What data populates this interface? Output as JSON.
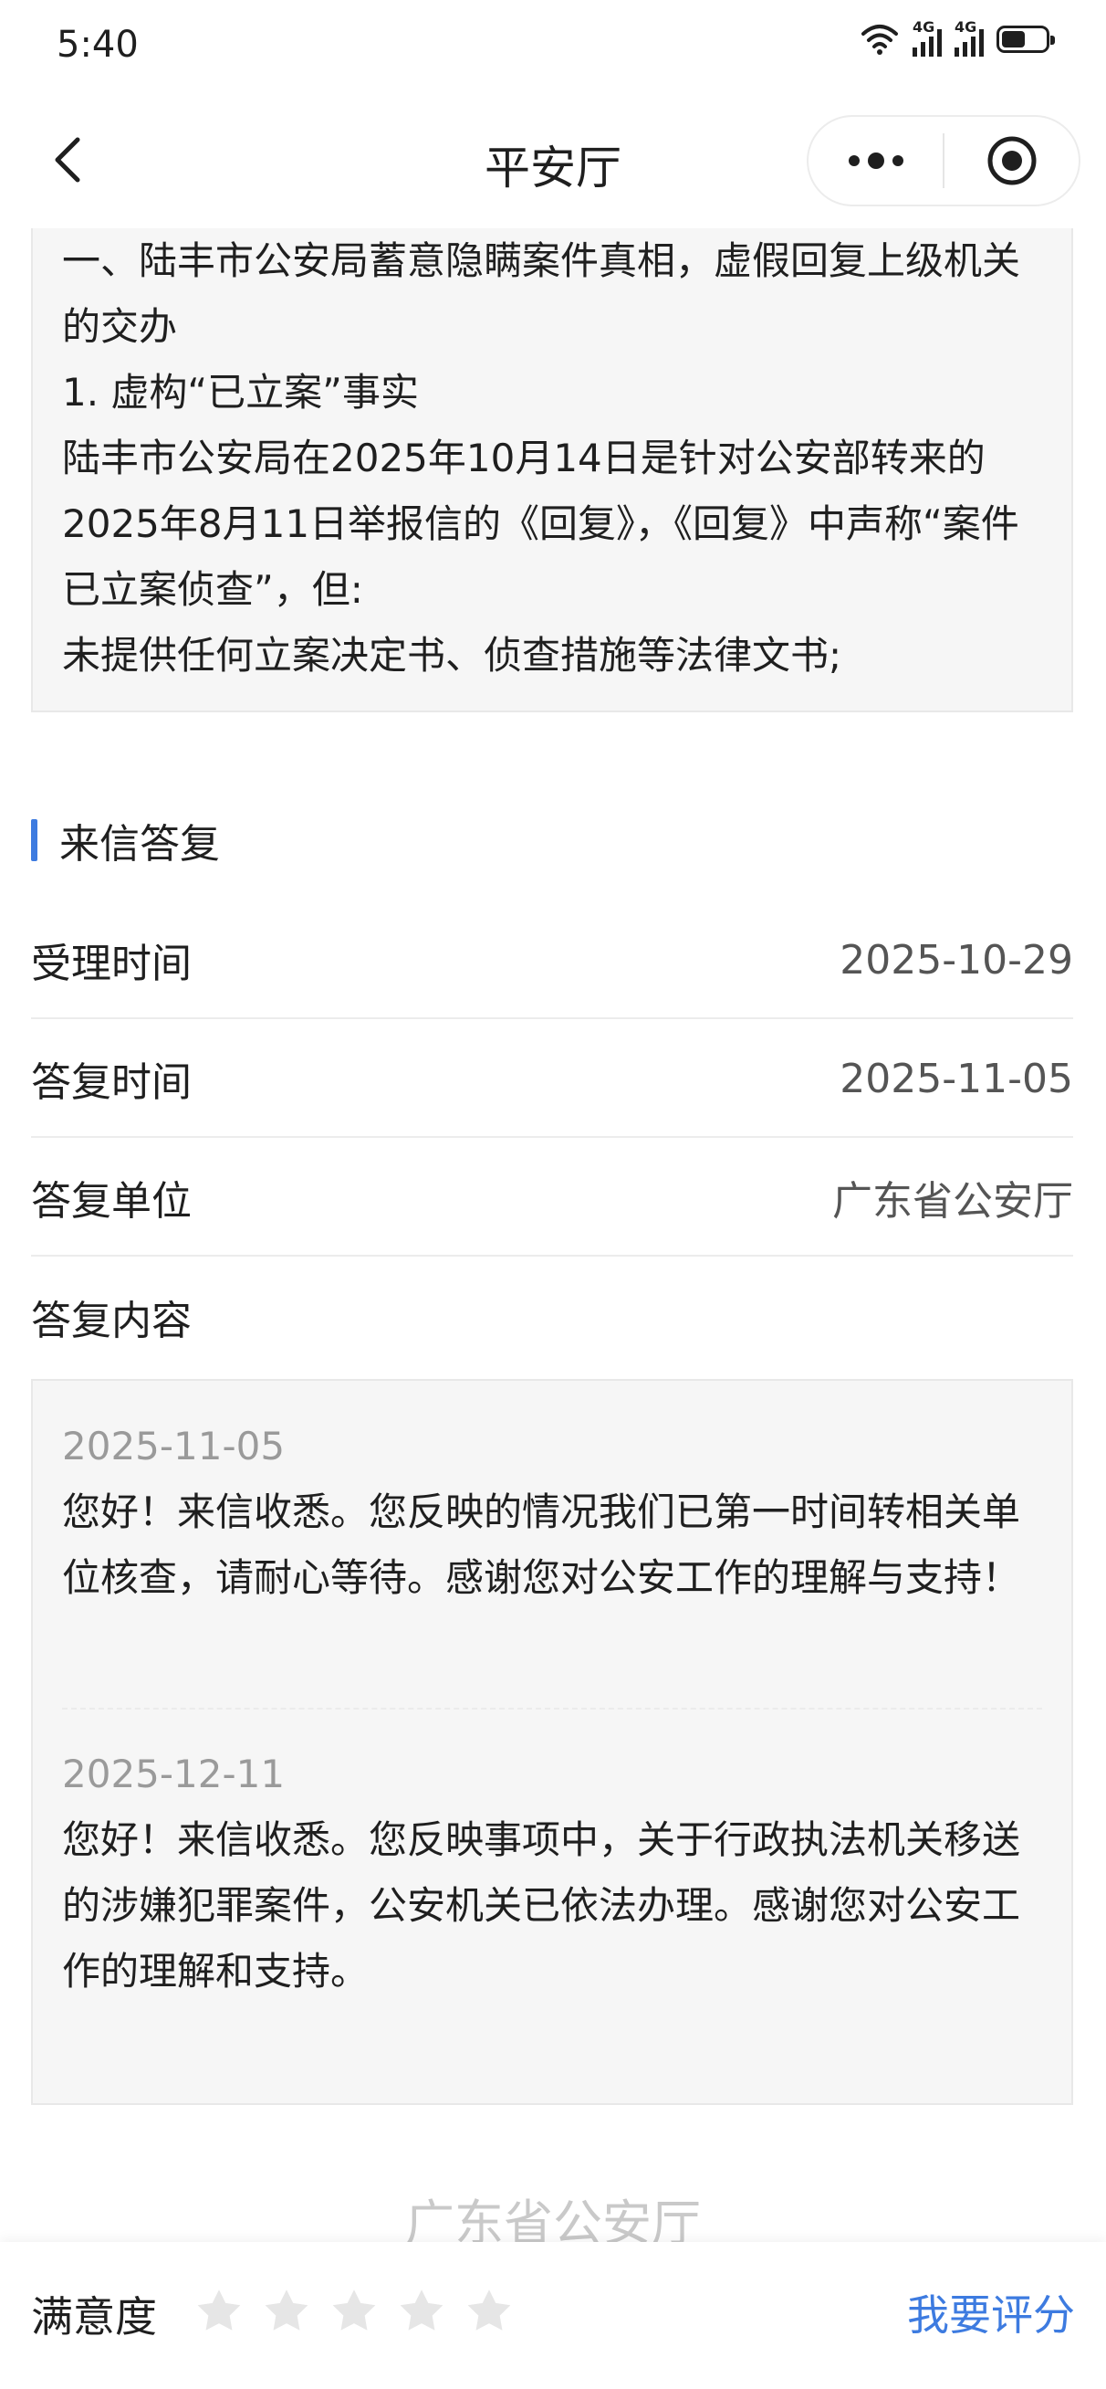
{
  "status": {
    "time": "5:40",
    "net1": "4G",
    "net2": "4G"
  },
  "nav": {
    "title": "平安厅"
  },
  "letter": {
    "lines": [
      "一、陆丰市公安局蓄意隐瞒案件真相，虚假回复上级机关的交办",
      "1. 虚构“已立案”事实",
      "陆丰市公安局在2025年10月14日是针对公安部转来的2025年8月11日举报信的《回复》，《回复》中声称“案件已立案侦查”，但:",
      "未提供任何立案决定书、侦查措施等法律文书;"
    ]
  },
  "reply_section": {
    "title": "来信答复",
    "rows": [
      {
        "label": "受理时间",
        "value": "2025-10-29"
      },
      {
        "label": "答复时间",
        "value": "2025-11-05"
      },
      {
        "label": "答复单位",
        "value": "广东省公安厅"
      },
      {
        "label": "答复内容",
        "value": ""
      }
    ],
    "replies": [
      {
        "date": "2025-11-05",
        "text": "您好！来信收悉。您反映的情况我们已第一时间转相关单位核查，请耐心等待。感谢您对公安工作的理解与支持！"
      },
      {
        "date": "2025-12-11",
        "text": "您好！来信收悉。您反映事项中，关于行政执法机关移送的涉嫌犯罪案件，公安机关已依法办理。感谢您对公安工作的理解和支持。"
      }
    ]
  },
  "footer": {
    "signature": "广东省公安厅"
  },
  "bottom": {
    "satisfaction_label": "满意度",
    "rating": 0,
    "max_rating": 5,
    "rate_button": "我要评分"
  },
  "colors": {
    "accent": "#3d7be0",
    "star_empty": "#e6e6e6"
  }
}
